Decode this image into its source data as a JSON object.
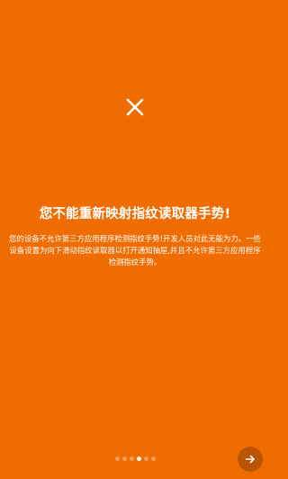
{
  "screen": {
    "background_color": "#ee6c00",
    "title": "您不能重新映射指纹读取器手势!",
    "body": "您的设备不允许第三方应用程序检测指纹手势!开发人员对此无能为力。一些设备设置为向下滑动指纹读取器以打开通知抽屉,并且不允许第三方应用程序检测指纹手势。"
  },
  "icons": {
    "close": "close-icon",
    "next": "arrow-right-icon"
  },
  "pager": {
    "total": 6,
    "current_index": 3
  }
}
